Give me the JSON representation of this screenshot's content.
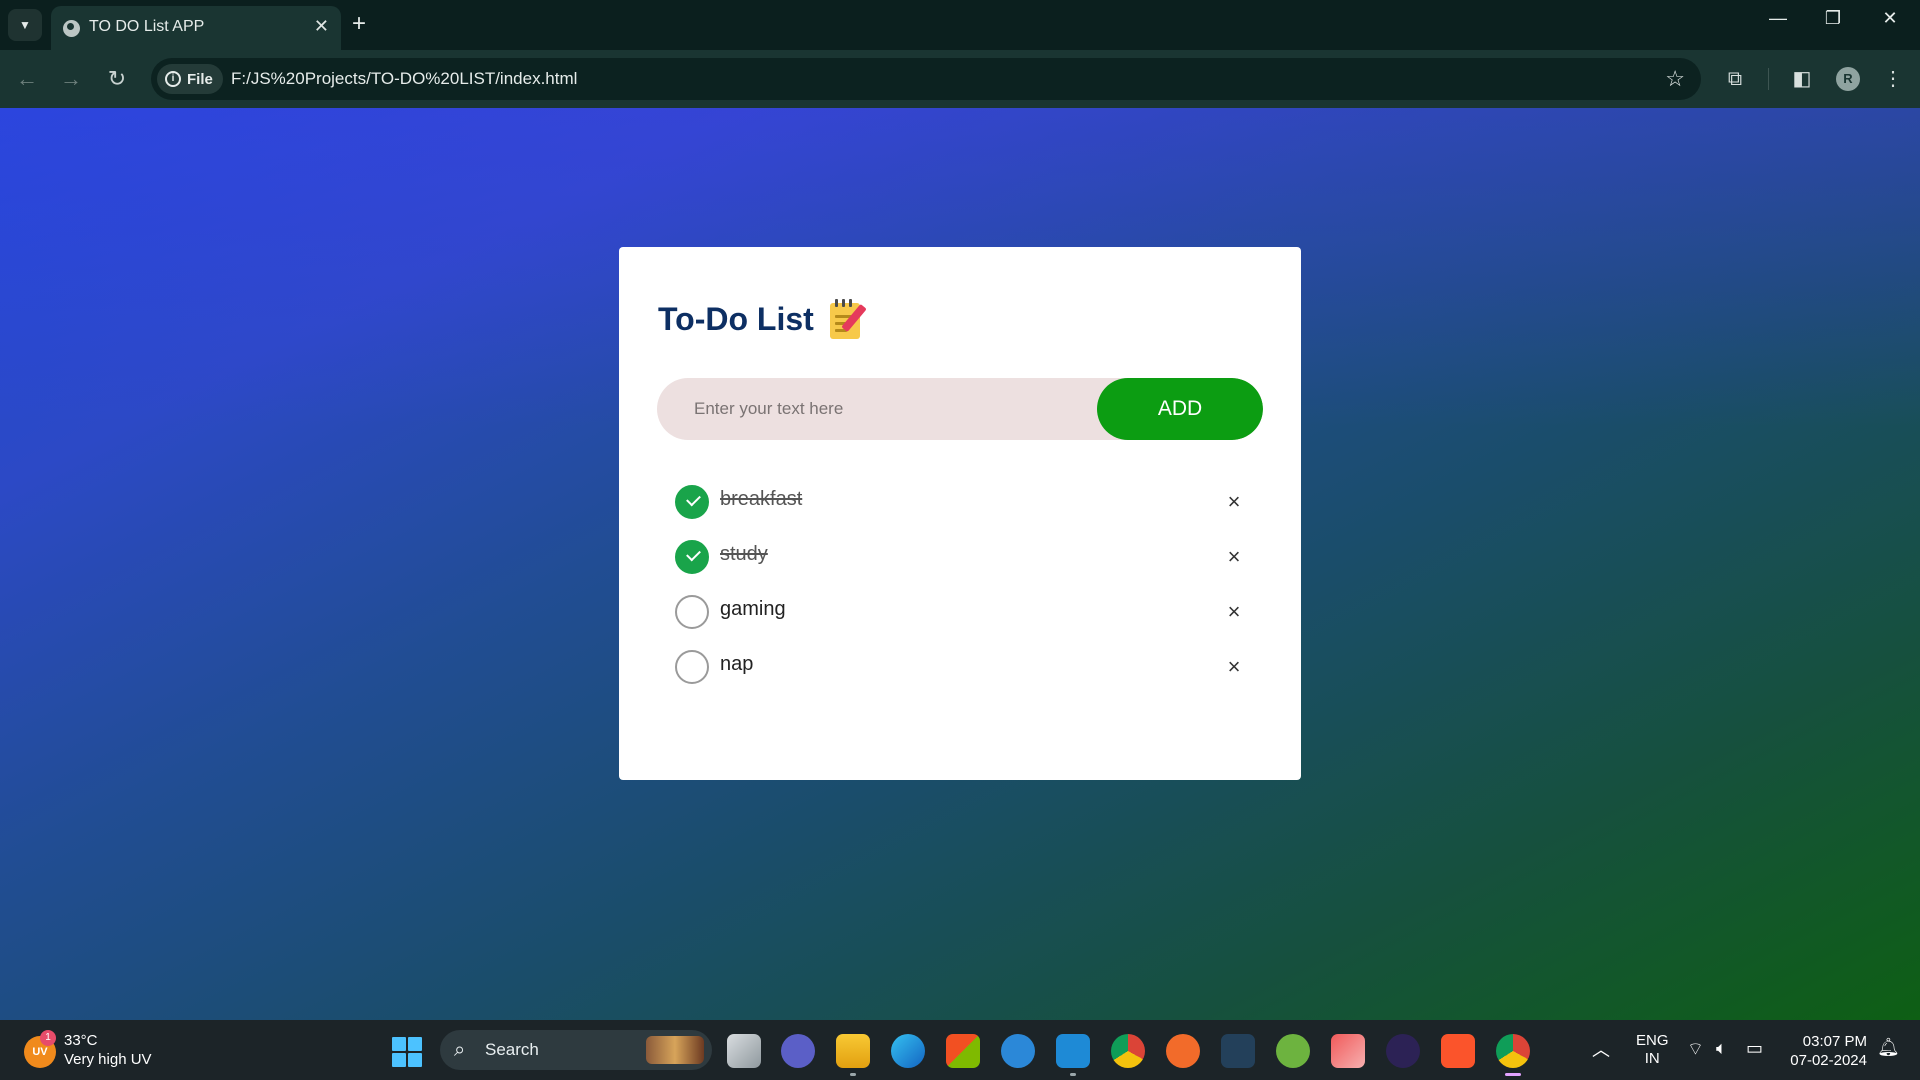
{
  "browser": {
    "tab_title": "TO DO List APP",
    "file_chip": "File",
    "url": "F:/JS%20Projects/TO-DO%20LIST/index.html",
    "profile_initial": "R"
  },
  "app": {
    "title": "To-Do List",
    "input_placeholder": "Enter your text here",
    "input_value": "",
    "add_label": "ADD",
    "items": [
      {
        "text": "breakfast",
        "checked": true
      },
      {
        "text": "study",
        "checked": true
      },
      {
        "text": "gaming",
        "checked": false
      },
      {
        "text": "nap",
        "checked": false
      }
    ],
    "remove_label": "×",
    "colors": {
      "heading": "#0d2f63",
      "add_button": "#0c9d12",
      "check": "#19a44a",
      "input_bg": "#ede0e0"
    }
  },
  "taskbar": {
    "weather_temp": "33°C",
    "weather_condition": "Very high UV",
    "uv_badge": "UV",
    "uv_count": "1",
    "search_label": "Search",
    "lang_line1": "ENG",
    "lang_line2": "IN",
    "time": "03:07 PM",
    "date": "07-02-2024"
  }
}
